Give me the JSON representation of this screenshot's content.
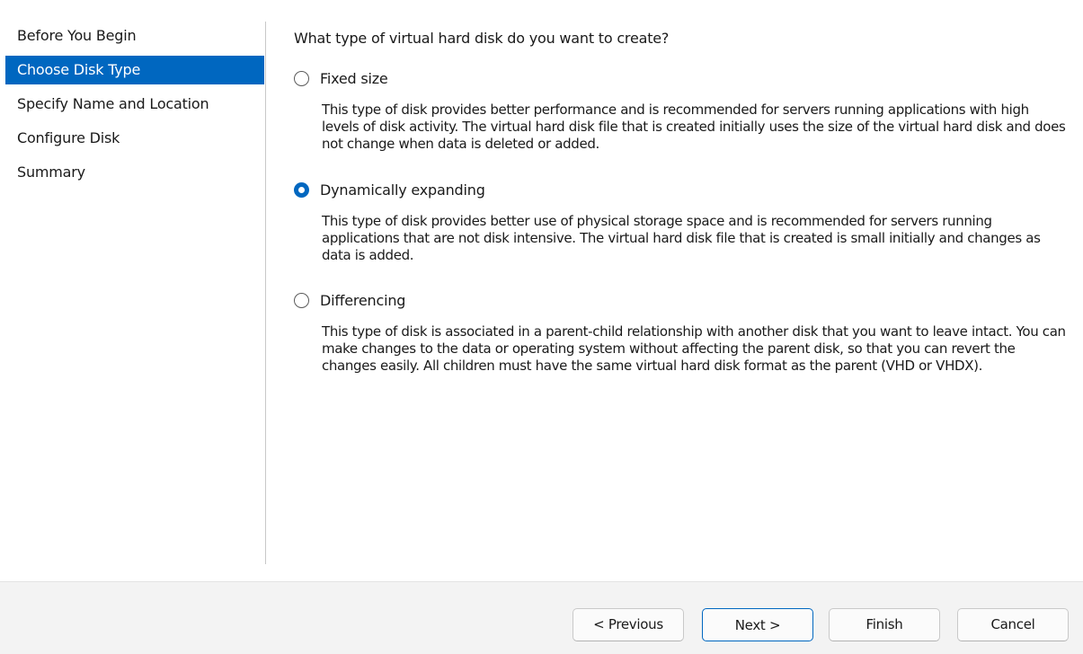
{
  "sidebar": {
    "items": [
      {
        "label": "Before You Begin"
      },
      {
        "label": "Choose Disk Type"
      },
      {
        "label": "Specify Name and Location"
      },
      {
        "label": "Configure Disk"
      },
      {
        "label": "Summary"
      }
    ],
    "selected": "Choose Disk Type"
  },
  "main": {
    "question": "What type of virtual hard disk do you want to create?",
    "options": [
      {
        "label": "Fixed size",
        "checked": false,
        "description": "This type of disk provides better performance and is recommended for servers running applications with high levels of disk activity. The virtual hard disk file that is created initially uses the size of the virtual hard disk and does not change when data is deleted or added."
      },
      {
        "label": "Dynamically expanding",
        "checked": true,
        "description": "This type of disk provides better use of physical storage space and is recommended for servers running applications that are not disk intensive. The virtual hard disk file that is created is small initially and changes as data is added."
      },
      {
        "label": "Differencing",
        "checked": false,
        "description": "This type of disk is associated in a parent-child relationship with another disk that you want to leave intact. You can make changes to the data or operating system without affecting the parent disk, so that you can revert the changes easily. All children must have the same virtual hard disk format as the parent (VHD or VHDX)."
      }
    ]
  },
  "footer": {
    "previous_label": "< Previous",
    "next_label": "Next >",
    "finish_label": "Finish",
    "cancel_label": "Cancel"
  },
  "colors": {
    "accent": "#0067c0",
    "footer_bg": "#f3f3f3"
  }
}
